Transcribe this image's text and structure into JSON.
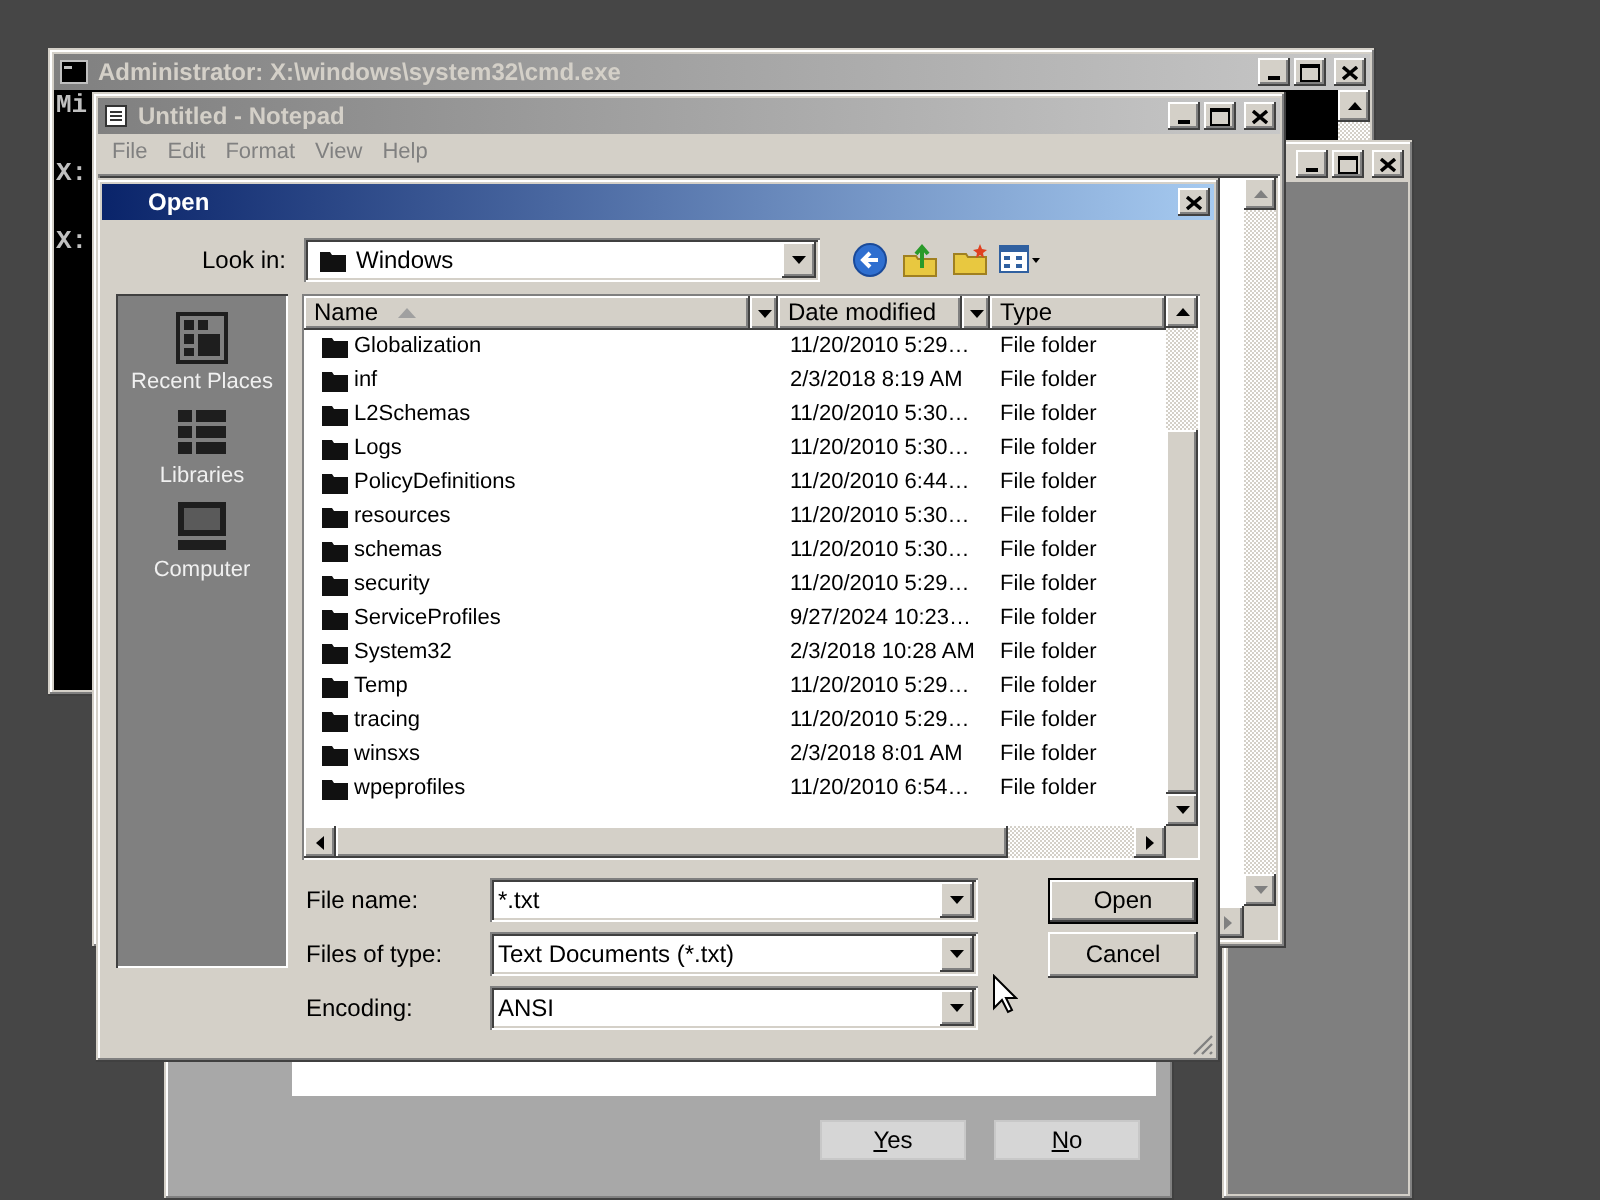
{
  "console_window": {
    "title": "Administrator: X:\\windows\\system32\\cmd.exe",
    "active": false,
    "lines": [
      "Mi",
      "X:",
      "X:"
    ]
  },
  "notepad_window": {
    "title": "Untitled - Notepad",
    "active": false,
    "menu": [
      "File",
      "Edit",
      "Format",
      "View",
      "Help"
    ]
  },
  "message_window": {
    "buttons": [
      {
        "label": "Yes",
        "mnemonic_first": true
      },
      {
        "label": "No",
        "mnemonic_first": true
      }
    ]
  },
  "open_dialog": {
    "title": "Open",
    "active": true,
    "look_in": {
      "label": "Look in:",
      "value": "Windows"
    },
    "places": [
      {
        "kind": "recent",
        "label": "Recent Places"
      },
      {
        "kind": "libraries",
        "label": "Libraries"
      },
      {
        "kind": "computer",
        "label": "Computer"
      }
    ],
    "columns": [
      {
        "label": "Name",
        "sorted": true
      },
      {
        "label": "Date modified",
        "sorted": false
      },
      {
        "label": "Type",
        "sorted": false
      }
    ],
    "rows": [
      {
        "name": "Globalization",
        "date": "11/20/2010 5:29…",
        "type": "File folder"
      },
      {
        "name": "inf",
        "date": "2/3/2018 8:19 AM",
        "type": "File folder"
      },
      {
        "name": "L2Schemas",
        "date": "11/20/2010 5:30…",
        "type": "File folder"
      },
      {
        "name": "Logs",
        "date": "11/20/2010 5:30…",
        "type": "File folder"
      },
      {
        "name": "PolicyDefinitions",
        "date": "11/20/2010 6:44…",
        "type": "File folder"
      },
      {
        "name": "resources",
        "date": "11/20/2010 5:30…",
        "type": "File folder"
      },
      {
        "name": "schemas",
        "date": "11/20/2010 5:30…",
        "type": "File folder"
      },
      {
        "name": "security",
        "date": "11/20/2010 5:29…",
        "type": "File folder"
      },
      {
        "name": "ServiceProfiles",
        "date": "9/27/2024 10:23…",
        "type": "File folder"
      },
      {
        "name": "System32",
        "date": "2/3/2018 10:28 AM",
        "type": "File folder"
      },
      {
        "name": "Temp",
        "date": "11/20/2010 5:29…",
        "type": "File folder"
      },
      {
        "name": "tracing",
        "date": "11/20/2010 5:29…",
        "type": "File folder"
      },
      {
        "name": "winsxs",
        "date": "2/3/2018 8:01 AM",
        "type": "File folder"
      },
      {
        "name": "wpeprofiles",
        "date": "11/20/2010 6:54…",
        "type": "File folder"
      }
    ],
    "fields": [
      {
        "label": "File name:",
        "value": "*.txt"
      },
      {
        "label": "Files of type:",
        "value": "Text Documents (*.txt)"
      },
      {
        "label": "Encoding:",
        "value": "ANSI"
      }
    ],
    "buttons": [
      {
        "label": "Open",
        "default": true
      },
      {
        "label": "Cancel",
        "default": false
      }
    ]
  }
}
